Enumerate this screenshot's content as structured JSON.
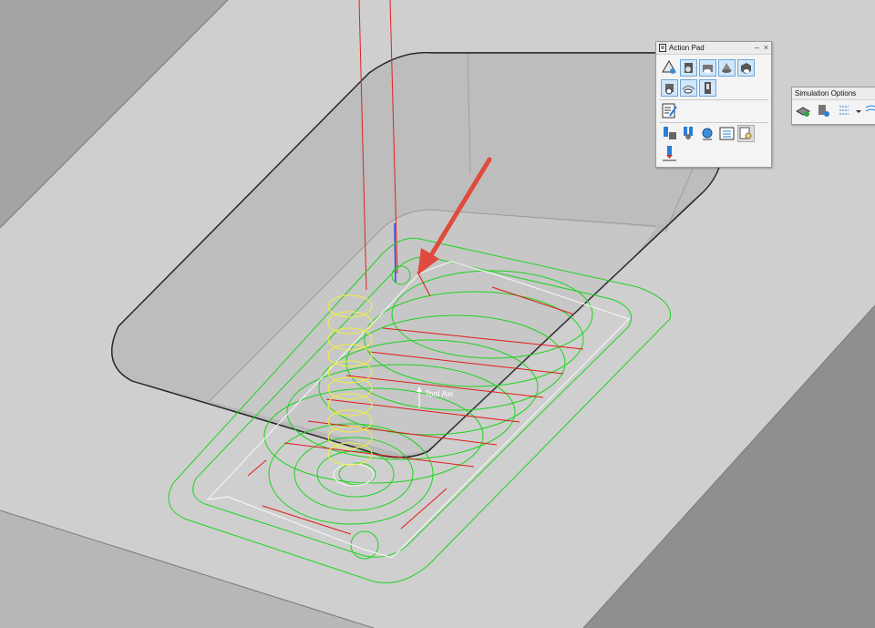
{
  "scene": {
    "annotation_label": "Tool Axi",
    "colors": {
      "part_top": "#cecece",
      "part_side": "#a3a3a3",
      "pocket_floor": "#c6c6c6",
      "pocket_wall": "#b5b5b5",
      "toolpath_cut": "#1fd31f",
      "toolpath_rapid": "#e11b1b",
      "helix_entry": "#f0f03c",
      "tool_axis": "#1a2bff",
      "arrow": "#e04b3e"
    }
  },
  "action_pad": {
    "title": "Action Pad",
    "minimize": "–",
    "close": "×",
    "buttons": [
      "verify-icon",
      "machine-sim-icon",
      "stock-view-icon",
      "fixture-view-icon",
      "part-view-icon",
      "tool-view-icon",
      "toolpath-display-icon",
      "gouge-check-icon",
      "edit-operation-icon",
      "tool-list-icon",
      "holder-icon",
      "analysis-icon",
      "list-icon",
      "inspect-icon",
      "cut-depth-icon"
    ]
  },
  "simulation_options": {
    "title": "Simulation Options",
    "buttons": [
      "sim-stock-icon",
      "sim-tool-icon",
      "sim-path-icon",
      "sim-dropdown-icon",
      "sim-extra-icon"
    ]
  }
}
